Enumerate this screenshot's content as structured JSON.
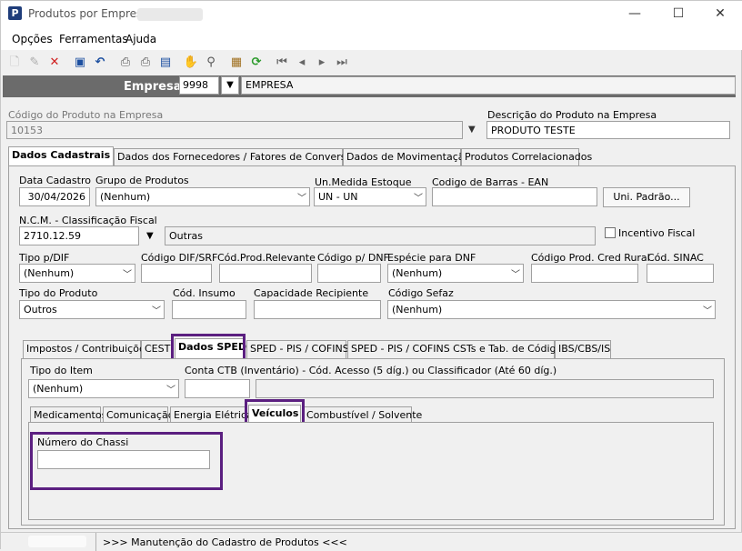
{
  "window": {
    "title": "Produtos por Empresa",
    "minimize": "—",
    "maximize": "☐",
    "close": "✕"
  },
  "menu": {
    "opcoes": "Opções",
    "ferramentas": "Ferramentas",
    "ajuda": "Ajuda"
  },
  "empresa": {
    "label": "Empresa",
    "code": "9998",
    "name": "EMPRESA"
  },
  "produto": {
    "codigo_label": "Código do Produto na Empresa",
    "codigo": "10153",
    "descricao_label": "Descrição do Produto na Empresa",
    "descricao": "PRODUTO TESTE"
  },
  "main_tabs": [
    "Dados Cadastrais",
    "Dados dos Fornecedores / Fatores de Conversão",
    "Dados de Movimentação",
    "Produtos Correlacionados"
  ],
  "form": {
    "data_cadastro_label": "Data Cadastro",
    "data_cadastro": "30/04/2026",
    "grupo_label": "Grupo de Produtos",
    "grupo": "(Nenhum)",
    "unmedida_label": "Un.Medida Estoque",
    "unmedida": "UN - UN",
    "ean_label": "Codigo de Barras - EAN",
    "ean": "",
    "uni_padrao": "Uni. Padrão...",
    "ncm_label": "N.C.M. -  Classificação Fiscal",
    "ncm": "2710.12.59",
    "ncm_desc": "Outras",
    "incentivo_label": "Incentivo Fiscal",
    "tipo_dif_label": "Tipo p/DIF",
    "tipo_dif": "(Nenhum)",
    "cod_dif_label": "Código DIF/SRF",
    "cod_relevante_label": "Cód.Prod.Relevante",
    "cod_dnf_label": "Código p/ DNF",
    "especie_dnf_label": "Espécie para DNF",
    "especie_dnf": "(Nenhum)",
    "cred_rural_label": "Código Prod. Cred Rural",
    "sinac_label": "Cód. SINAC",
    "tipo_produto_label": "Tipo do Produto",
    "tipo_produto": "Outros",
    "insumo_label": "Cód. Insumo",
    "capacidade_label": "Capacidade Recipiente",
    "sefaz_label": "Código Sefaz",
    "sefaz": "(Nenhum)"
  },
  "sub_tabs": [
    "Impostos / Contribuições",
    "CEST",
    "Dados SPED",
    "SPED - PIS / COFINS",
    "SPED - PIS / COFINS CSTs e Tab. de Códigos",
    "IBS/CBS/IS"
  ],
  "sped": {
    "tipo_item_label": "Tipo do Item",
    "tipo_item": "(Nenhum)",
    "conta_ctb_label": "Conta CTB (Inventário) - Cód. Acesso (5 díg.) ou Classificador (Até 60 díg.)"
  },
  "inner_tabs": [
    "Medicamentos",
    "Comunicação",
    "Energia Elétrica",
    "Veículos",
    "Combustível / Solvente"
  ],
  "veiculos": {
    "chassi_label": "Número do Chassi",
    "chassi": ""
  },
  "status": {
    "message": ">>> Manutenção do Cadastro de Produtos <<<"
  },
  "colors": {
    "highlight": "#5b1f80",
    "empresa_bar": "#6b6b6b"
  }
}
